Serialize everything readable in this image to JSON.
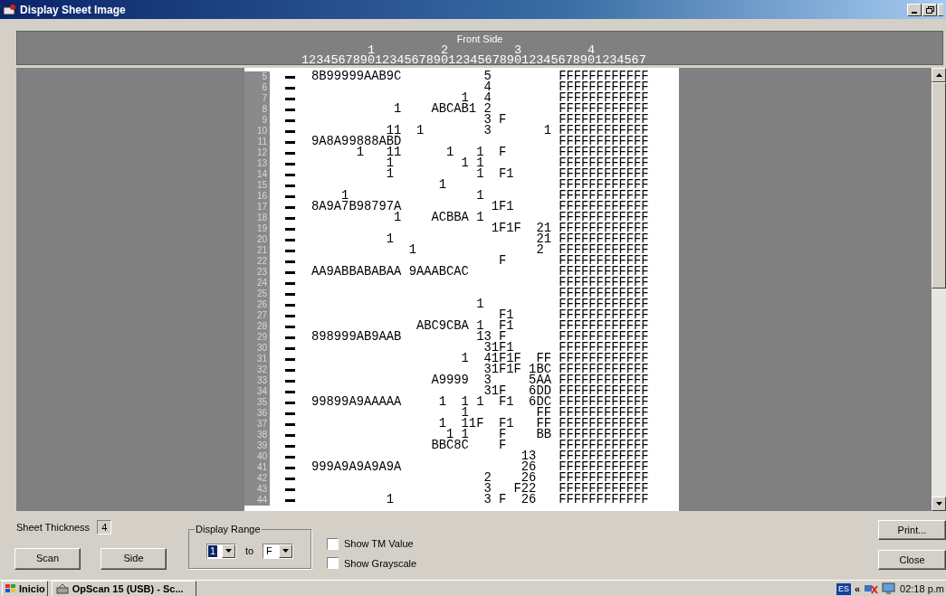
{
  "window": {
    "title": "Display Sheet Image"
  },
  "sheet": {
    "side": "Front Side",
    "ruler_tens": "         1         2         3         4",
    "ruler_units": "12345678901234567890123456789012345678901234567",
    "rows": [
      {
        "number": "5",
        "data": "8B99999AAB9C           5         FFFFFFFFFFFF"
      },
      {
        "number": "6",
        "data": "                       4         FFFFFFFFFFFF"
      },
      {
        "number": "7",
        "data": "                    1  4         FFFFFFFFFFFF"
      },
      {
        "number": "8",
        "data": "           1    ABCAB1 2         FFFFFFFFFFFF"
      },
      {
        "number": "9",
        "data": "                       3 F       FFFFFFFFFFFF"
      },
      {
        "number": "10",
        "data": "          11  1        3       1 FFFFFFFFFFFF"
      },
      {
        "number": "11",
        "data": "9A8A99888ABD                     FFFFFFFFFFFF"
      },
      {
        "number": "12",
        "data": "      1   11      1   1  F       FFFFFFFFFFFF"
      },
      {
        "number": "13",
        "data": "          1         1 1          FFFFFFFFFFFF"
      },
      {
        "number": "14",
        "data": "          1           1  F1      FFFFFFFFFFFF"
      },
      {
        "number": "15",
        "data": "                 1               FFFFFFFFFFFF"
      },
      {
        "number": "16",
        "data": "    1                 1          FFFFFFFFFFFF"
      },
      {
        "number": "17",
        "data": "8A9A7B98797A            1F1      FFFFFFFFFFFF"
      },
      {
        "number": "18",
        "data": "           1    ACBBA 1          FFFFFFFFFFFF"
      },
      {
        "number": "19",
        "data": "                        1F1F  21 FFFFFFFFFFFF"
      },
      {
        "number": "20",
        "data": "          1                   21 FFFFFFFFFFFF"
      },
      {
        "number": "21",
        "data": "             1                2  FFFFFFFFFFFF"
      },
      {
        "number": "22",
        "data": "                         F       FFFFFFFFFFFF"
      },
      {
        "number": "23",
        "data": "AA9ABBABABAA 9AAABCAC            FFFFFFFFFFFF"
      },
      {
        "number": "24",
        "data": "                                 FFFFFFFFFFFF"
      },
      {
        "number": "25",
        "data": "                                 FFFFFFFFFFFF"
      },
      {
        "number": "26",
        "data": "                      1          FFFFFFFFFFFF"
      },
      {
        "number": "27",
        "data": "                         F1      FFFFFFFFFFFF"
      },
      {
        "number": "28",
        "data": "              ABC9CBA 1  F1      FFFFFFFFFFFF"
      },
      {
        "number": "29",
        "data": "898999AB9AAB          13 F       FFFFFFFFFFFF"
      },
      {
        "number": "30",
        "data": "                       31F1      FFFFFFFFFFFF"
      },
      {
        "number": "31",
        "data": "                    1  41F1F  FF FFFFFFFFFFFF"
      },
      {
        "number": "32",
        "data": "                       31F1F 1BC FFFFFFFFFFFF"
      },
      {
        "number": "33",
        "data": "                A9999  3     5AA FFFFFFFFFFFF"
      },
      {
        "number": "34",
        "data": "                       31F   6DD FFFFFFFFFFFF"
      },
      {
        "number": "35",
        "data": "99899A9AAAAA     1  1 1  F1  6DC FFFFFFFFFFFF"
      },
      {
        "number": "36",
        "data": "                    1         FF FFFFFFFFFFFF"
      },
      {
        "number": "37",
        "data": "                 1  11F  F1   FF FFFFFFFFFFFF"
      },
      {
        "number": "38",
        "data": "                  1 1    F    BB FFFFFFFFFFFF"
      },
      {
        "number": "39",
        "data": "                BBC8C    F       FFFFFFFFFFFF"
      },
      {
        "number": "40",
        "data": "                            13   FFFFFFFFFFFF"
      },
      {
        "number": "41",
        "data": "999A9A9A9A9A                26   FFFFFFFFFFFF"
      },
      {
        "number": "42",
        "data": "                       2    26   FFFFFFFFFFFF"
      },
      {
        "number": "43",
        "data": "                       3   F22   FFFFFFFFFFFF"
      },
      {
        "number": "44",
        "data": "          1            3 F  26   FFFFFFFFFFFF"
      }
    ]
  },
  "controls": {
    "thickness_label": "Sheet Thickness",
    "thickness_value": "4",
    "buttons_left": [
      "Scan",
      "Side"
    ],
    "range": {
      "label": "Display Range",
      "from": {
        "value": "1",
        "focused": true
      },
      "to_label": "to",
      "to": {
        "value": "F",
        "focused": false
      }
    },
    "checkboxes": [
      {
        "label": "Show TM Value",
        "checked": false
      },
      {
        "label": "Show Grayscale",
        "checked": false
      }
    ],
    "buttons_right": [
      "Print...",
      "Close"
    ]
  },
  "taskbar": {
    "start": "Inicio",
    "task": "OpScan 15 (USB) - Sc...",
    "language": "ES",
    "chevron": "«",
    "clock": "02:18 p.m"
  }
}
